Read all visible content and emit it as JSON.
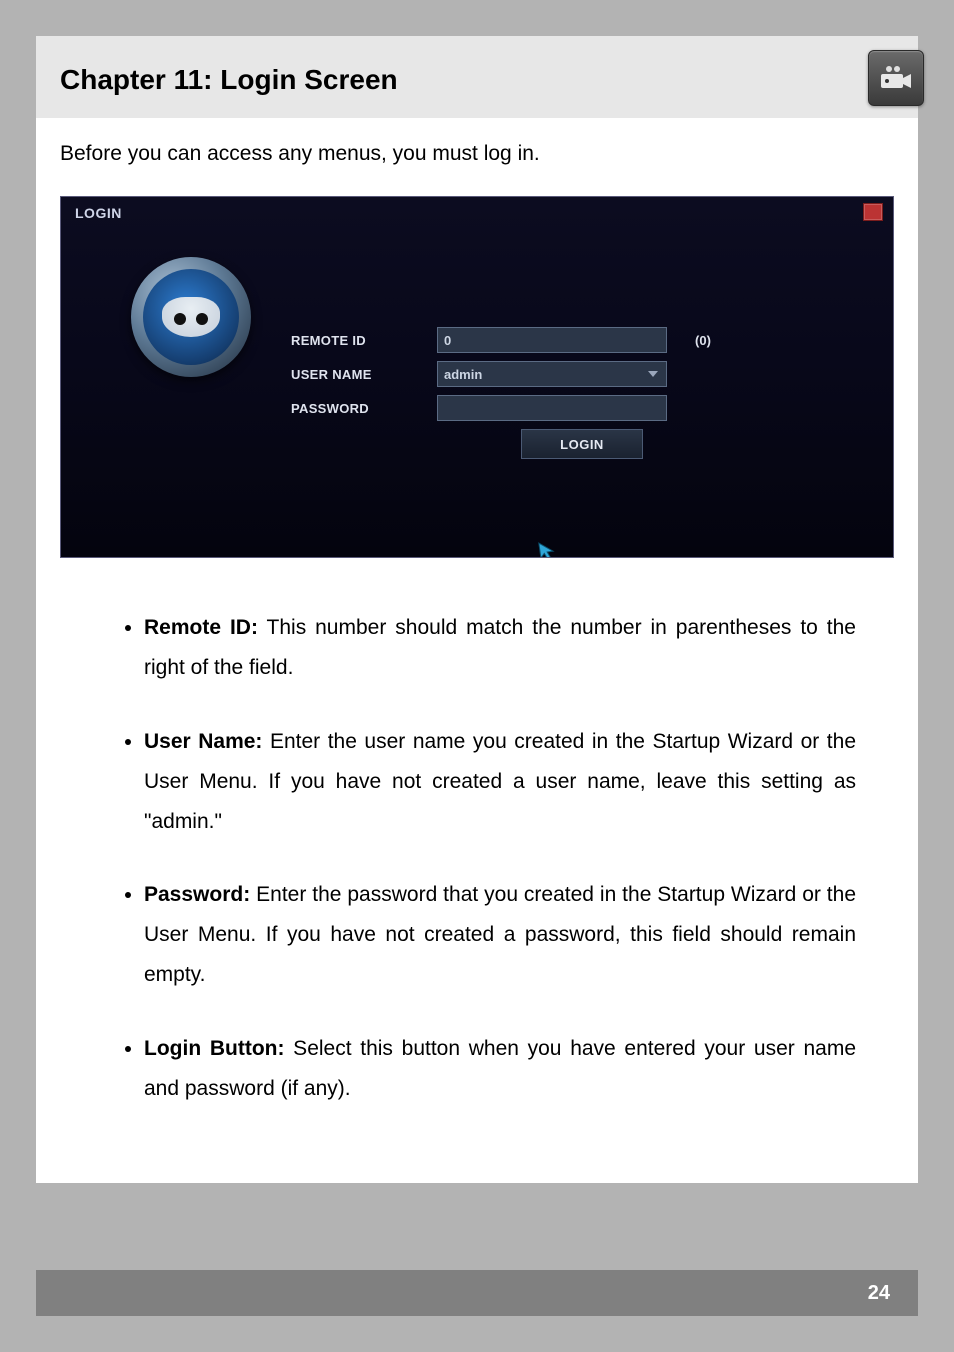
{
  "chapter": {
    "title": "Chapter 11: Login Screen"
  },
  "intro": "Before you can access any menus, you must log in.",
  "shot": {
    "title": "LOGIN",
    "labels": {
      "remote_id": "REMOTE ID",
      "user_name": "USER NAME",
      "password": "PASSWORD"
    },
    "values": {
      "remote_id": "0",
      "remote_id_hint": "(0)",
      "user_name": "admin",
      "password": ""
    },
    "login_button": "LOGIN"
  },
  "bullets": [
    {
      "term": "Remote ID:",
      "text": " This number should match the number in parentheses to the right of the field."
    },
    {
      "term": "User Name:",
      "text": " Enter the user name you created in the Startup Wizard or the User Menu. If you have not created a user name, leave this setting as \"admin.\""
    },
    {
      "term": "Password:",
      "text": " Enter the password that you created in the Startup Wizard or the User Menu. If you have not created a password, this field should remain empty."
    },
    {
      "term": "Login Button:",
      "text": " Select this button when you have entered your user name and password (if any)."
    }
  ],
  "page_number": "24"
}
